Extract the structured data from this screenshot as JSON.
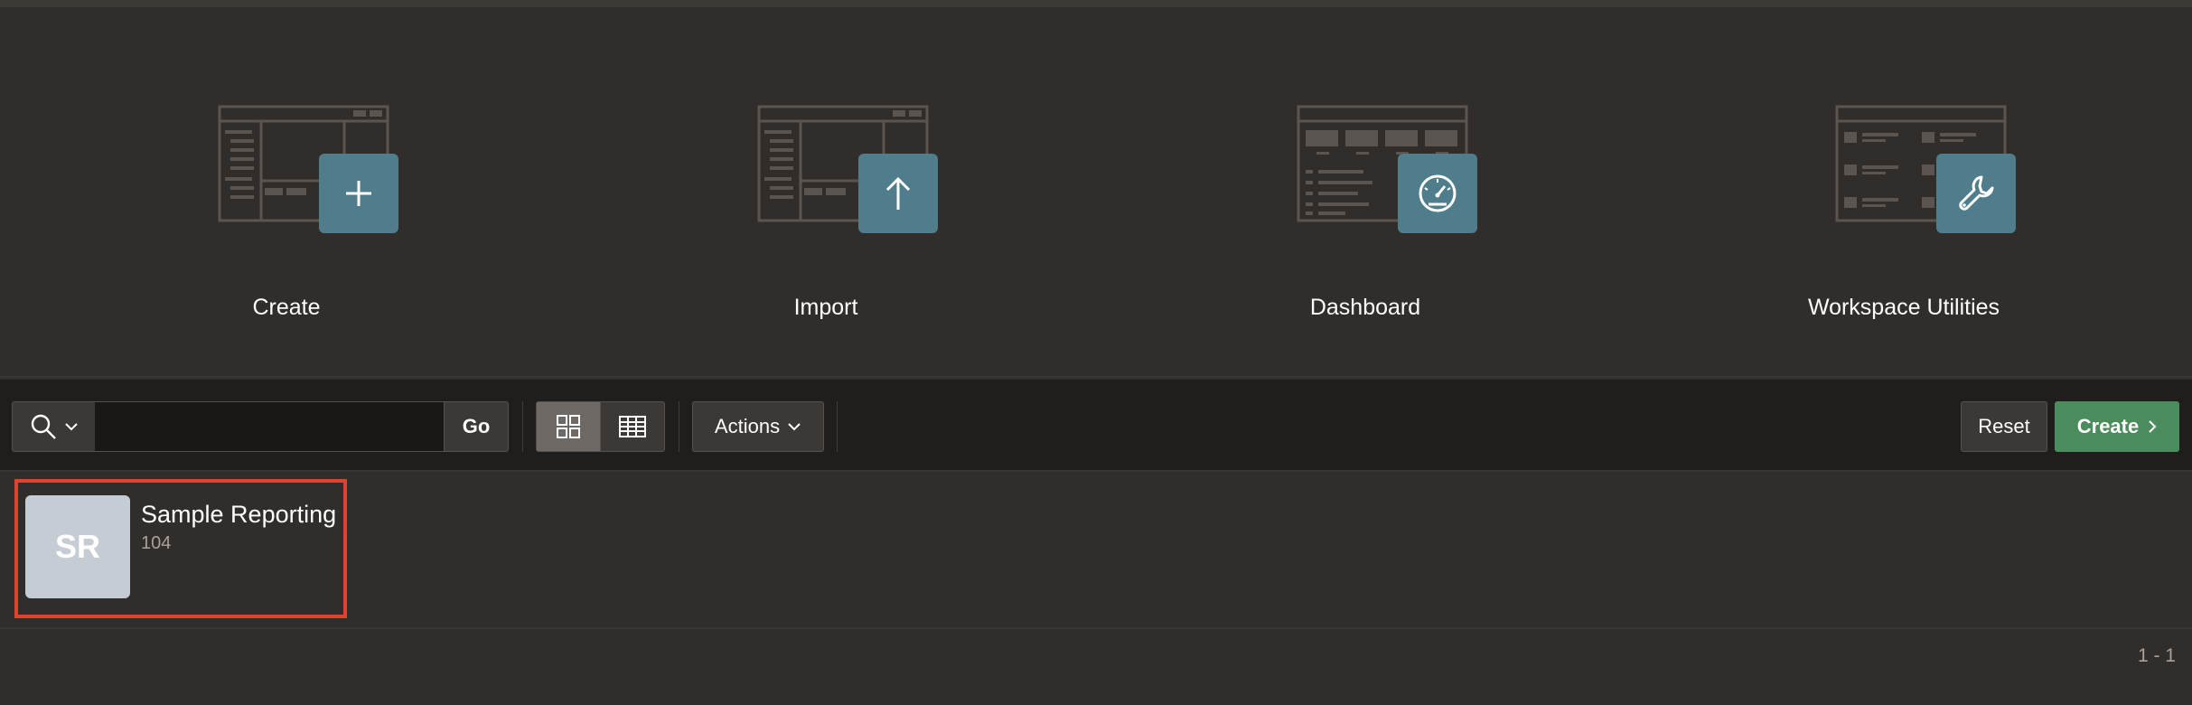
{
  "hero": {
    "tiles": [
      {
        "label": "Create",
        "icon": "plus-icon"
      },
      {
        "label": "Import",
        "icon": "arrow-up-icon"
      },
      {
        "label": "Dashboard",
        "icon": "gauge-icon"
      },
      {
        "label": "Workspace Utilities",
        "icon": "wrench-icon"
      }
    ],
    "badge_color": "#4f7d8c"
  },
  "toolbar": {
    "search_icon": "search-icon",
    "search_value": "",
    "go_label": "Go",
    "view_modes": [
      "grid-view-icon",
      "table-view-icon"
    ],
    "actions_label": "Actions",
    "reset_label": "Reset",
    "create_label": "Create",
    "create_color": "#4a8c5c"
  },
  "apps": [
    {
      "initials": "SR",
      "name": "Sample Reporting",
      "id": "104"
    }
  ],
  "pagination": "1 - 1"
}
